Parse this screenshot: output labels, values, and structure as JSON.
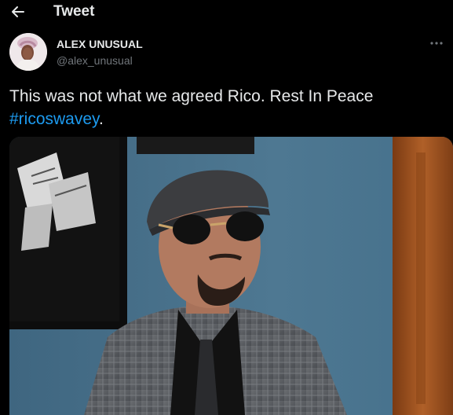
{
  "header": {
    "back_icon": "arrow-left-icon",
    "title": "Tweet"
  },
  "author": {
    "display_name": "ALEX UNUSUAL",
    "handle": "@alex_unusual",
    "more_icon": "more-dots-icon"
  },
  "tweet": {
    "text": "This was not what we agreed Rico. Rest In Peace",
    "hashtag": "#ricoswavey",
    "trailing": "."
  },
  "colors": {
    "background": "#000000",
    "text": "#e7e9ea",
    "secondary": "#71767b",
    "link": "#1d9bf0"
  }
}
